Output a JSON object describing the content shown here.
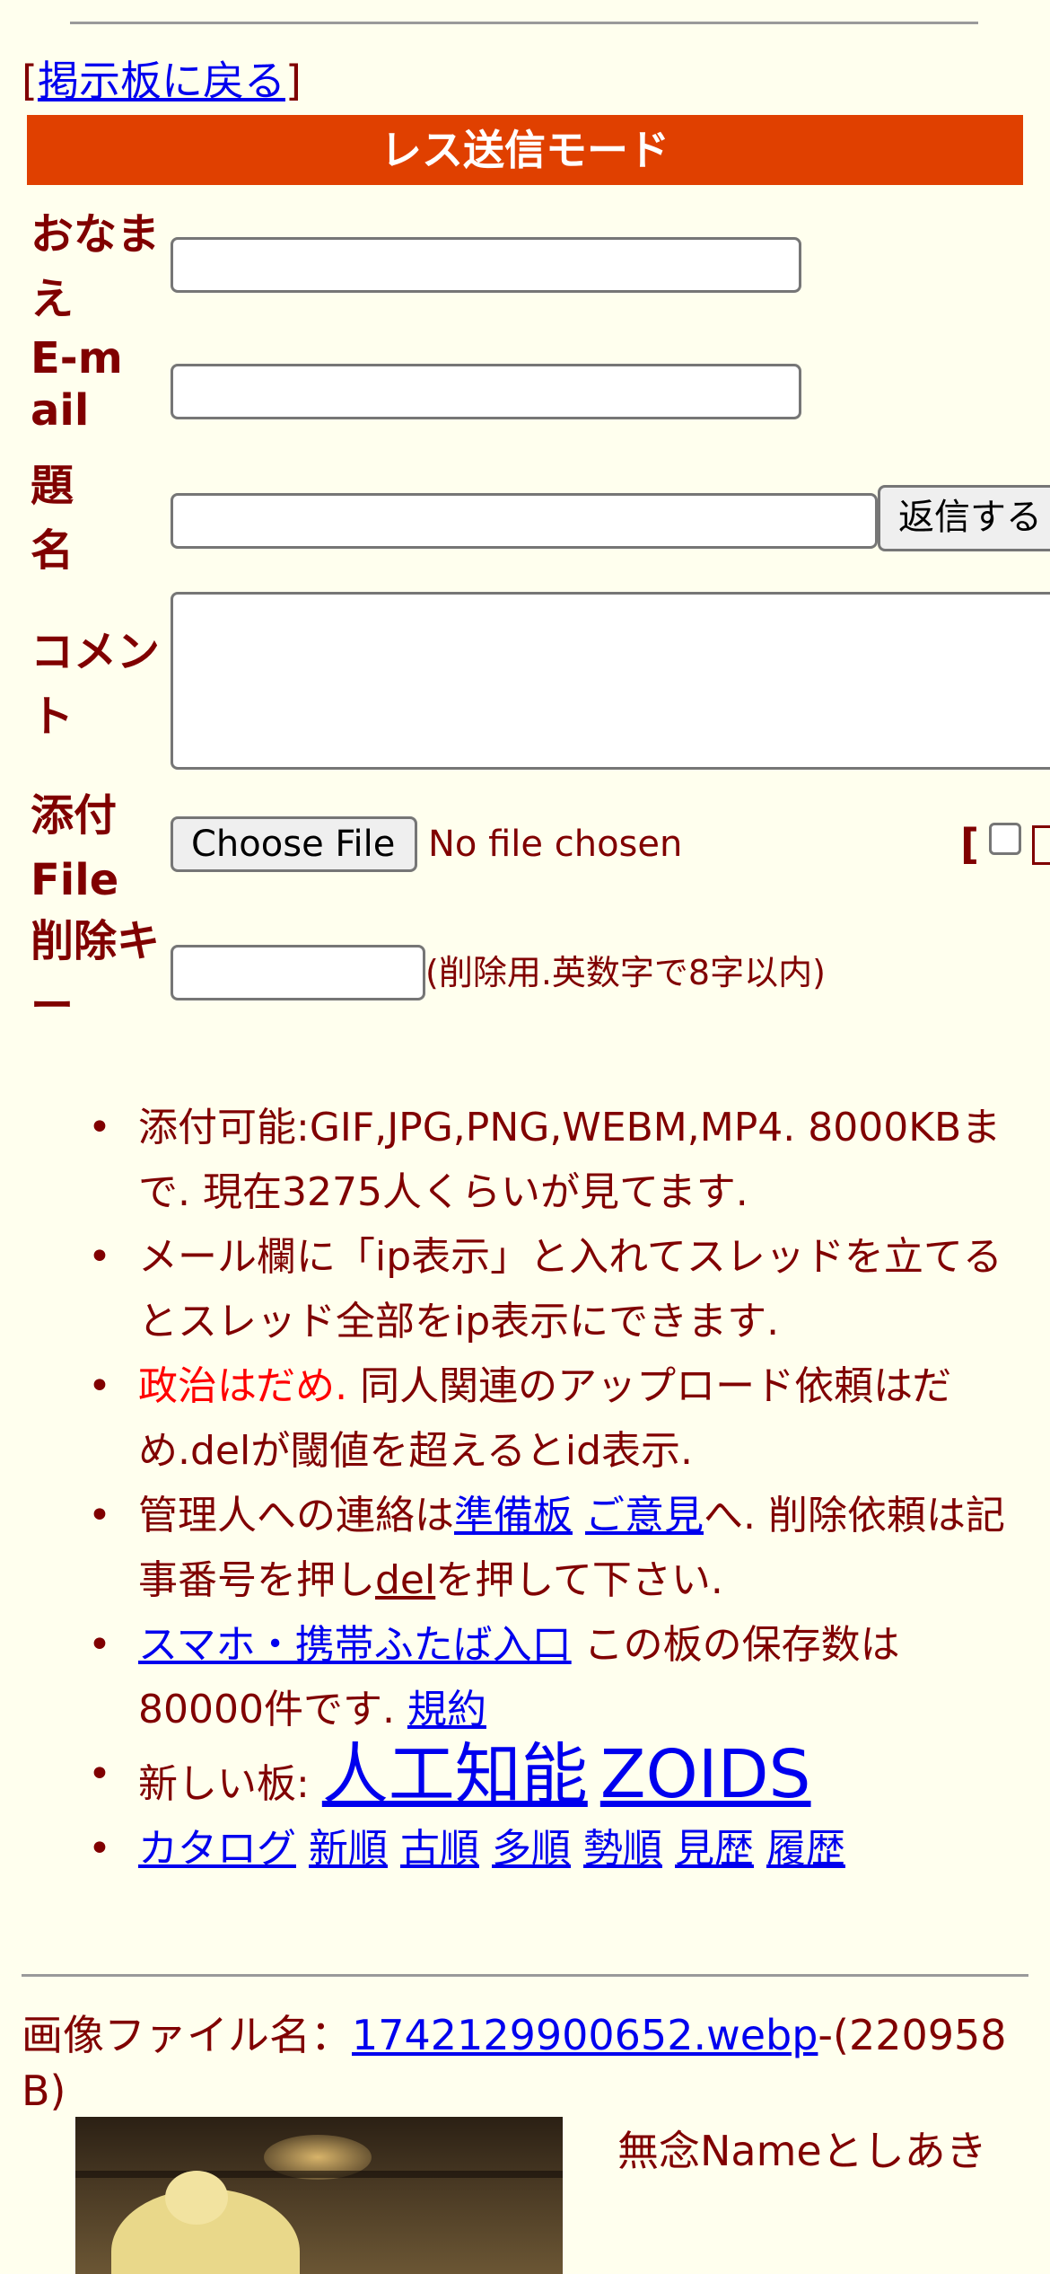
{
  "top_nav": {
    "bracket_open": "[",
    "back_link": "掲示板に戻る",
    "bracket_close": "]"
  },
  "form": {
    "title": "レス送信モード",
    "name_label": "おなまえ",
    "email_label": "E-mail",
    "subject_label": "題名",
    "submit_label": "返信する",
    "comment_label": "コメント",
    "file_label": "添付File",
    "choose_file": "Choose File",
    "no_file": "No file chosen",
    "right_bracket": "[",
    "delkey_label": "削除キー",
    "delkey_hint": "(削除用.英数字で8字以内)"
  },
  "rules": {
    "r1": "添付可能:GIF,JPG,PNG,WEBM,MP4. 8000KBまで. 現在3275人くらいが見てます.",
    "r2": "メール欄に「ip表示」と入れてスレッドを立てるとスレッド全部をip表示にできます.",
    "r3_red": "政治はだめ.",
    "r3_rest": " 同人関連のアップロード依頼はだめ.delが閾値を超えるとid表示.",
    "r4_a": "管理人への連絡は",
    "r4_link1": "準備板",
    "r4_link2": "ご意見",
    "r4_b": "へ. 削除依頼は記事番号を押し",
    "r4_link3": "del",
    "r4_c": "を押して下さい.",
    "r5_link": "スマホ・携帯ふたば入口",
    "r5_a": " この板の保存数は80000件です. ",
    "r5_link2": "規約",
    "r6_a": "新しい板: ",
    "r6_link1": "人工知能",
    "r6_link2": "ZOIDS",
    "nav": [
      "カタログ",
      "新順",
      "古順",
      "多順",
      "勢順",
      "見歴",
      "履歴"
    ]
  },
  "post": {
    "file_prefix": "画像ファイル名：",
    "file_link": "1742129900652.webp",
    "file_size": "-(220958 B)",
    "author": "無念Nameとしあき"
  },
  "colors": {
    "background": "#ffffee",
    "text": "#800000",
    "header": "#e04000",
    "link": "#0000ee",
    "alert": "#ff0000"
  }
}
